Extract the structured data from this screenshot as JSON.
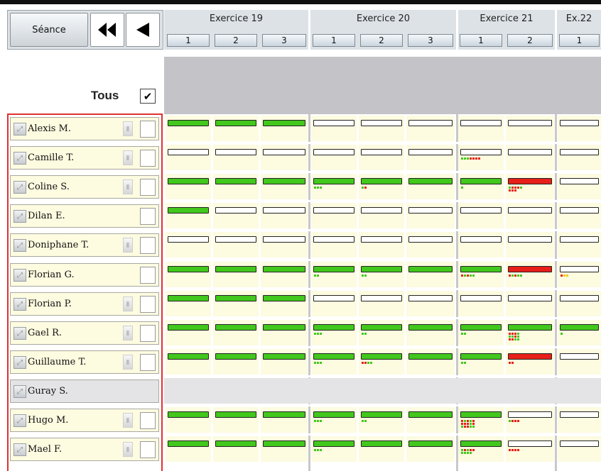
{
  "controls": {
    "seance_label": "Séance",
    "first_icon": "double-left-arrow-icon",
    "prev_icon": "left-arrow-icon"
  },
  "exercises": [
    {
      "title": "Exercice 19",
      "sessions": [
        "1",
        "2",
        "3"
      ]
    },
    {
      "title": "Exercice 20",
      "sessions": [
        "1",
        "2",
        "3"
      ]
    },
    {
      "title": "Exercice 21",
      "sessions": [
        "1",
        "2"
      ]
    },
    {
      "title": "Ex.22",
      "sessions": [
        "1"
      ]
    }
  ],
  "tous": {
    "label": "Tous",
    "checked": true,
    "check_glyph": "✔"
  },
  "colors": {
    "green": "#42c81c",
    "red": "#e81e18",
    "yellow": "#f0c800",
    "cell_bg": "#fdfbe0",
    "absent_bg": "#e4e4e6",
    "frame_red": "#e03030"
  },
  "students": [
    {
      "name": "Alexis M.",
      "absent": false,
      "bars": [
        "green",
        "green",
        "green",
        "white",
        "white",
        "white",
        "white",
        "white",
        "white"
      ],
      "marks": [
        "",
        "",
        "",
        "",
        "",
        "",
        "",
        "",
        ""
      ]
    },
    {
      "name": "Camille T.",
      "absent": false,
      "bars": [
        "white",
        "white",
        "white",
        "white",
        "white",
        "white",
        "white",
        "white",
        "white"
      ],
      "marks": [
        "",
        "",
        "",
        "",
        "",
        "",
        "gggrrrr",
        "",
        ""
      ]
    },
    {
      "name": "Coline S.",
      "absent": false,
      "bars": [
        "green",
        "green",
        "green",
        "green",
        "green",
        "green",
        "green",
        "red",
        "white"
      ],
      "marks": [
        "",
        "",
        "",
        "ggg",
        "gr",
        "",
        "g",
        "grrrg|rrr",
        ""
      ]
    },
    {
      "name": "Dilan E.",
      "absent": false,
      "bars": [
        "green",
        "white",
        "white",
        "white",
        "white",
        "white",
        "white",
        "white",
        "white"
      ],
      "marks": [
        "",
        "",
        "",
        "",
        "",
        "",
        "",
        "",
        ""
      ]
    },
    {
      "name": "Doniphane T.",
      "absent": false,
      "bars": [
        "white",
        "white",
        "white",
        "white",
        "white",
        "white",
        "white",
        "white",
        "white"
      ],
      "marks": [
        "",
        "",
        "",
        "",
        "",
        "",
        "",
        "",
        ""
      ]
    },
    {
      "name": "Florian G.",
      "absent": false,
      "bars": [
        "green",
        "green",
        "green",
        "green",
        "green",
        "green",
        "green",
        "red",
        "white"
      ],
      "marks": [
        "",
        "",
        "",
        "gg",
        "gg",
        "",
        "rgrgg",
        "rgrgg",
        "ryy"
      ]
    },
    {
      "name": "Florian P.",
      "absent": false,
      "bars": [
        "green",
        "green",
        "green",
        "white",
        "white",
        "white",
        "white",
        "white",
        "white"
      ],
      "marks": [
        "",
        "",
        "",
        "",
        "",
        "",
        "",
        "",
        ""
      ]
    },
    {
      "name": "Gael R.",
      "absent": false,
      "bars": [
        "green",
        "green",
        "green",
        "green",
        "green",
        "green",
        "green",
        "green",
        "green"
      ],
      "marks": [
        "",
        "",
        "",
        "ggg",
        "gg",
        "",
        "gg",
        "rrrg|ggrg|rrgg",
        "g"
      ]
    },
    {
      "name": "Guillaume T.",
      "absent": false,
      "bars": [
        "green",
        "green",
        "green",
        "green",
        "green",
        "green",
        "green",
        "red",
        "white"
      ],
      "marks": [
        "",
        "",
        "",
        "ggg",
        "rrgg",
        "",
        "gg",
        "rr",
        ""
      ]
    },
    {
      "name": "Guray S.",
      "absent": true,
      "bars": [],
      "marks": []
    },
    {
      "name": "Hugo M.",
      "absent": false,
      "bars": [
        "green",
        "green",
        "green",
        "green",
        "green",
        "green",
        "green",
        "white",
        "white"
      ],
      "marks": [
        "",
        "",
        "",
        "ggg",
        "gg",
        "",
        "rgrgr|rrrgr|grrgg",
        "grrr",
        ""
      ]
    },
    {
      "name": "Mael F.",
      "absent": false,
      "bars": [
        "green",
        "green",
        "green",
        "green",
        "green",
        "green",
        "green",
        "white",
        "white"
      ],
      "marks": [
        "",
        "",
        "",
        "ggg",
        "",
        "",
        "grgrr|gggg",
        "rrrr",
        ""
      ]
    }
  ]
}
